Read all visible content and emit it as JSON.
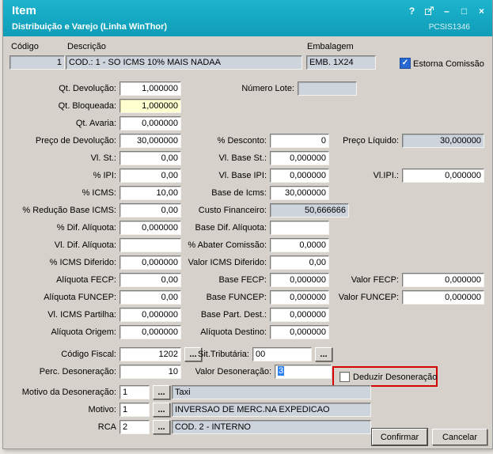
{
  "colors": {
    "titlebar-light": "#1db4cd",
    "titlebar-dark": "#0f9db8",
    "dialog-bg": "#d6d2cb",
    "readonly-bg": "#cdd4dc",
    "blocked-bg": "#ffffcf",
    "check-blue": "#2767d2",
    "selection": "#2e7ff0",
    "highlight-red": "#d40000"
  },
  "window": {
    "title": "Item",
    "subtitle": "Distribuição e Varejo (Linha WinThor)",
    "program_code": "PCSIS1346",
    "controls": {
      "help": "?",
      "minimize": "–",
      "maximize": "□",
      "close": "×"
    }
  },
  "top": {
    "codigo": {
      "label": "Código",
      "value": "1"
    },
    "descricao": {
      "label": "Descrição",
      "value": "COD.: 1 - SO ICMS 10% MAIS NADAA"
    },
    "embalagem": {
      "label": "Embalagem",
      "value": "EMB. 1X24"
    },
    "estorna": {
      "label": "Estorna Comissão",
      "checked": true,
      "glyph": "✓"
    }
  },
  "fields": {
    "qt_devolucao": {
      "label": "Qt. Devolução:",
      "value": "1,000000"
    },
    "numero_lote": {
      "label": "Número Lote:",
      "value": ""
    },
    "qt_bloqueada": {
      "label": "Qt. Bloqueada:",
      "value": "1,000000"
    },
    "qt_avaria": {
      "label": "Qt. Avaria:",
      "value": "0,000000"
    },
    "preco_devolucao": {
      "label": "Preço de Devolução:",
      "value": "30,000000"
    },
    "desconto": {
      "label": "% Desconto:",
      "value": "0"
    },
    "preco_liquido": {
      "label": "Preço Líquido:",
      "value": "30,000000"
    },
    "vl_st": {
      "label": "Vl. St.:",
      "value": "0,00"
    },
    "vl_base_st": {
      "label": "Vl. Base St.:",
      "value": "0,000000"
    },
    "ipi": {
      "label": "% IPI:",
      "value": "0,00"
    },
    "vl_base_ipi": {
      "label": "Vl. Base IPI:",
      "value": "0,000000"
    },
    "vl_ipi": {
      "label": "Vl.IPI.:",
      "value": "0,000000"
    },
    "icms": {
      "label": "% ICMS:",
      "value": "10,00"
    },
    "base_icms": {
      "label": "Base de Icms:",
      "value": "30,000000"
    },
    "reducao_base_icms": {
      "label": "% Redução Base ICMS:",
      "value": "0,00"
    },
    "custo_financeiro": {
      "label": "Custo Financeiro:",
      "value": "50,666666"
    },
    "dif_aliquota": {
      "label": "% Dif. Alíquota:",
      "value": "0,000000"
    },
    "base_dif_aliquota": {
      "label": "Base Dif. Alíquota:",
      "value": ""
    },
    "vl_dif_aliquota": {
      "label": "Vl. Dif. Alíquota:",
      "value": ""
    },
    "abater_comissao": {
      "label": "% Abater Comissão:",
      "value": "0,0000"
    },
    "icms_diferido": {
      "label": "% ICMS Diferido:",
      "value": "0,000000"
    },
    "valor_icms_diferido": {
      "label": "Valor ICMS Diferido:",
      "value": "0,00"
    },
    "aliquota_fecp": {
      "label": "Alíquota FECP:",
      "value": "0,00"
    },
    "base_fecp": {
      "label": "Base FECP:",
      "value": "0,000000"
    },
    "valor_fecp": {
      "label": "Valor FECP:",
      "value": "0,000000"
    },
    "aliquota_funcep": {
      "label": "Alíquota FUNCEP:",
      "value": "0,00"
    },
    "base_funcep": {
      "label": "Base FUNCEP:",
      "value": "0,000000"
    },
    "valor_funcep": {
      "label": "Valor FUNCEP:",
      "value": "0,000000"
    },
    "vl_icms_partilha": {
      "label": "Vl. ICMS Partilha:",
      "value": "0,000000"
    },
    "base_part_dest": {
      "label": "Base Part. Dest.:",
      "value": "0,000000"
    },
    "aliquota_origem": {
      "label": "Alíquota Origem:",
      "value": "0,000000"
    },
    "aliquota_destino": {
      "label": "Alíquota Destino:",
      "value": "0,000000"
    },
    "codigo_fiscal": {
      "label": "Código Fiscal:",
      "value": "1202"
    },
    "sit_tributaria": {
      "label": "Sit.Tributária:",
      "value": "00"
    },
    "perc_desoneracao": {
      "label": "Perc. Desoneração:",
      "value": "10"
    },
    "valor_desoneracao": {
      "label": "Valor Desoneração:",
      "value": "3"
    },
    "deduzir_desoneracao": {
      "label": "Deduzir Desoneração",
      "checked": false
    },
    "motivo_desoneracao": {
      "label": "Motivo da Desoneração:",
      "value": "1",
      "desc": "Taxi"
    },
    "motivo": {
      "label": "Motivo:",
      "value": "1",
      "desc": "INVERSAO DE MERC.NA EXPEDICAO"
    },
    "rca": {
      "label": "RCA",
      "value": "2",
      "desc": "COD. 2 - INTERNO"
    }
  },
  "buttons": {
    "confirmar": "Confirmar",
    "cancelar": "Cancelar",
    "ellipsis": "..."
  }
}
